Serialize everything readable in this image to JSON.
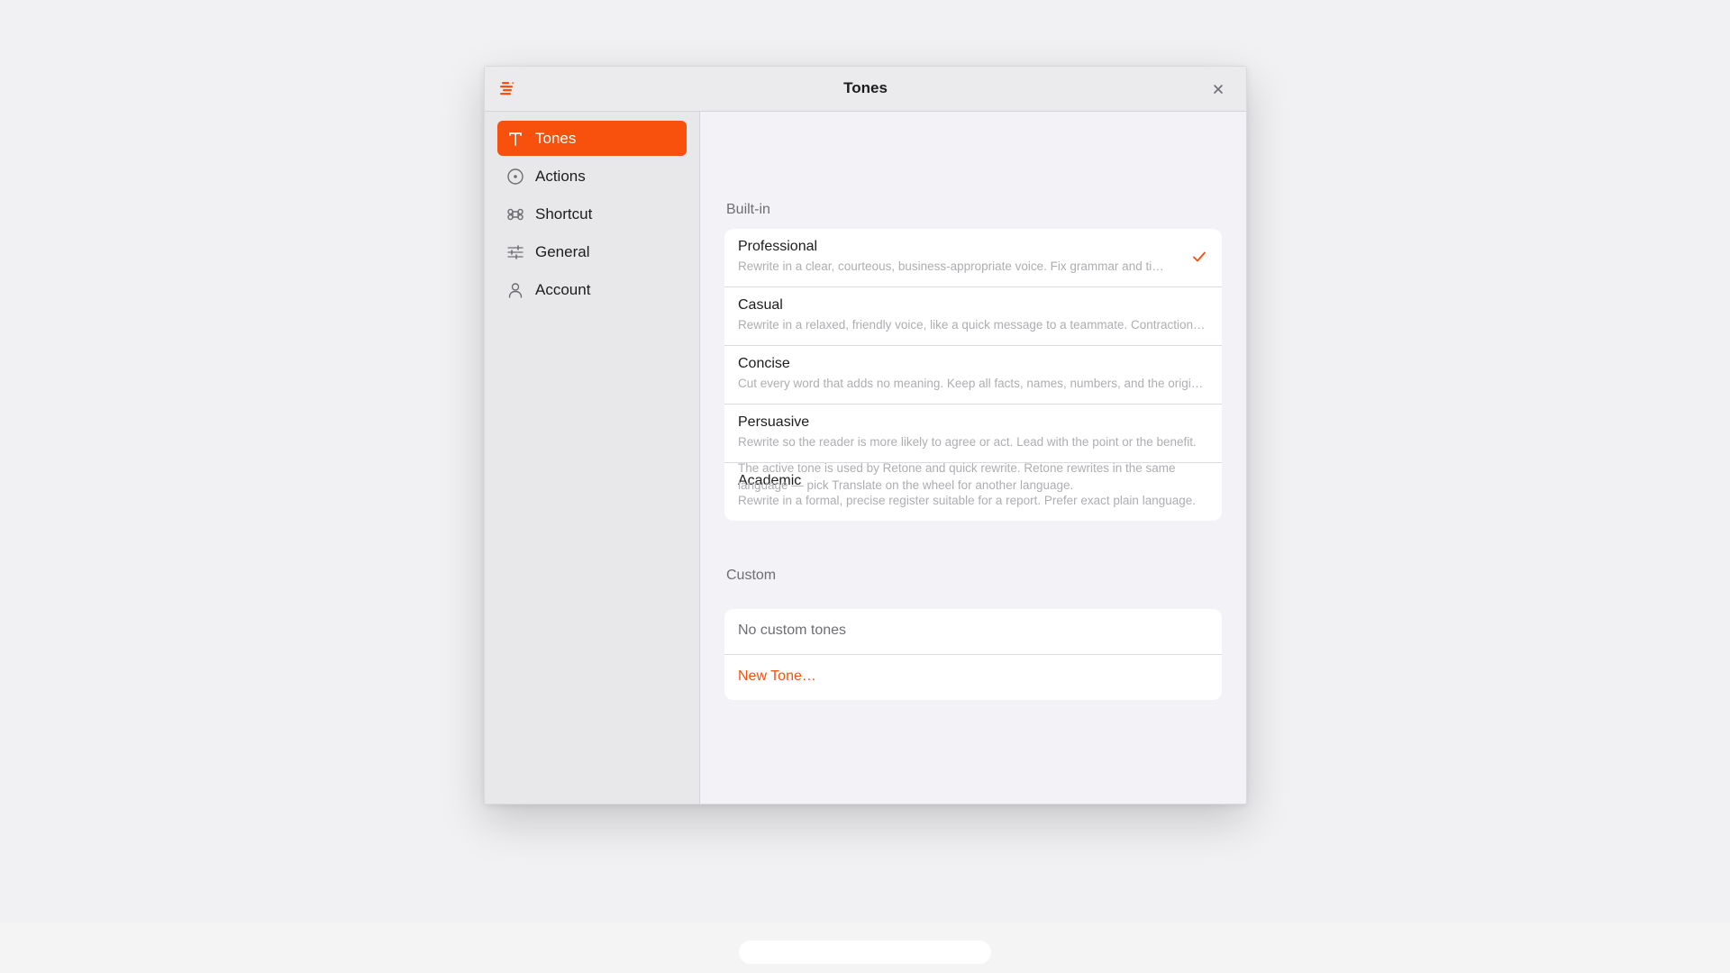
{
  "window": {
    "title": "Tones"
  },
  "colors": {
    "accent": "#f8500d",
    "sidebar_bg": "#e8e8eb",
    "content_bg": "#f2f2f7"
  },
  "sidebar": {
    "items": [
      {
        "label": "Tones",
        "icon": "text-t-icon",
        "active": true
      },
      {
        "label": "Actions",
        "icon": "circle-dot-icon",
        "active": false
      },
      {
        "label": "Shortcut",
        "icon": "command-icon",
        "active": false
      },
      {
        "label": "General",
        "icon": "sliders-icon",
        "active": false
      },
      {
        "label": "Account",
        "icon": "person-icon",
        "active": false
      }
    ]
  },
  "builtin": {
    "title": "Built-in",
    "tones": [
      {
        "name": "Professional",
        "description": "Rewrite in a clear, courteous, business-appropriate voice. Fix grammar and tighten structure.",
        "selected": true
      },
      {
        "name": "Casual",
        "description": "Rewrite in a relaxed, friendly voice, like a quick message to a teammate. Contractions are fine.",
        "selected": false
      },
      {
        "name": "Concise",
        "description": "Cut every word that adds no meaning. Keep all facts, names, numbers, and the original intent.",
        "selected": false
      },
      {
        "name": "Persuasive",
        "description": "Rewrite so the reader is more likely to agree or act. Lead with the point or the benefit.",
        "selected": false
      },
      {
        "name": "Academic",
        "description": "Rewrite in a formal, precise register suitable for a report. Prefer exact plain language.",
        "selected": false
      }
    ],
    "footnote": "The active tone is used by Retone and quick rewrite. Retone rewrites in the same language — pick Translate on the wheel for another language."
  },
  "custom": {
    "title": "Custom",
    "empty_text": "No custom tones",
    "new_button": "New Tone…"
  }
}
